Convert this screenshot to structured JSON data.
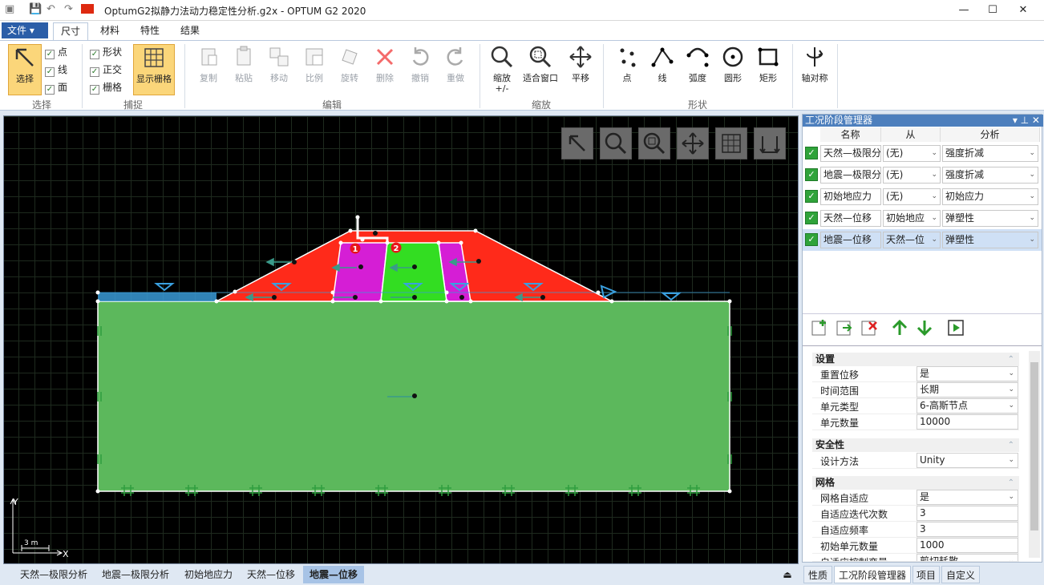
{
  "window": {
    "title": "OptumG2拟静力法动力稳定性分析.g2x - OPTUM G2 2020"
  },
  "menu": {
    "file": "文件 ▾",
    "tabs": [
      "尺寸",
      "材料",
      "特性",
      "结果"
    ]
  },
  "ribbon": {
    "select_group": {
      "label": "选择",
      "select_button": "选择",
      "checks": [
        "点",
        "线",
        "面"
      ]
    },
    "snap_group": {
      "label": "捕捉",
      "checks": [
        "形状",
        "正交",
        "栅格"
      ],
      "grid_button": "显示栅格"
    },
    "edit_group": {
      "label": "编辑",
      "buttons": [
        "复制",
        "粘贴",
        "移动",
        "比例",
        "旋转",
        "删除",
        "撤销",
        "重做"
      ]
    },
    "zoom_group": {
      "label": "缩放",
      "buttons": [
        "缩放\n+/-",
        "适合窗口",
        "平移"
      ],
      "zoom_line1": "缩放",
      "zoom_line2": "+/-"
    },
    "shape_group": {
      "label": "形状",
      "buttons": [
        "点",
        "线",
        "弧度",
        "圆形",
        "矩形"
      ]
    },
    "axis_button": "轴对称"
  },
  "canvas": {
    "axes": {
      "x": "X",
      "y": "Y",
      "scale": "3 m"
    },
    "markers": [
      "1",
      "2"
    ]
  },
  "bottom_tabs": [
    "天然—极限分析",
    "地震—极限分析",
    "初始地应力",
    "天然—位移",
    "地震—位移"
  ],
  "active_bottom_tab": "地震—位移",
  "stage_manager": {
    "title": "工况阶段管理器",
    "columns": [
      "名称",
      "从",
      "分析"
    ],
    "rows": [
      {
        "name": "天然—极限分",
        "from": "(无)",
        "analysis": "强度折减"
      },
      {
        "name": "地震—极限分",
        "from": "(无)",
        "analysis": "强度折减"
      },
      {
        "name": "初始地应力",
        "from": "(无)",
        "analysis": "初始应力"
      },
      {
        "name": "天然—位移",
        "from": "初始地应",
        "analysis": "弹塑性"
      },
      {
        "name": "地震—位移",
        "from": "天然—位",
        "analysis": "弹塑性"
      }
    ]
  },
  "properties": {
    "settings": {
      "title": "设置",
      "items": [
        {
          "key": "重置位移",
          "value": "是",
          "dropdown": true
        },
        {
          "key": "时间范围",
          "value": "长期",
          "dropdown": true
        },
        {
          "key": "单元类型",
          "value": "6-高斯节点",
          "dropdown": true
        },
        {
          "key": "单元数量",
          "value": "10000",
          "dropdown": false
        }
      ]
    },
    "safety": {
      "title": "安全性",
      "items": [
        {
          "key": "设计方法",
          "value": "Unity",
          "dropdown": true
        }
      ]
    },
    "mesh": {
      "title": "网格",
      "items": [
        {
          "key": "网格自适应",
          "value": "是",
          "dropdown": true
        },
        {
          "key": "自适应迭代次数",
          "value": "3",
          "dropdown": false
        },
        {
          "key": "自适应频率",
          "value": "3",
          "dropdown": false
        },
        {
          "key": "初始单元数量",
          "value": "1000",
          "dropdown": false
        },
        {
          "key": "自适应控制变量",
          "value": "剪切耗散",
          "dropdown": true
        }
      ]
    }
  },
  "panel_tabs": [
    "性质",
    "工况阶段管理器",
    "项目",
    "自定义"
  ],
  "colors": {
    "soil_green": "#5cb85c",
    "red": "#ff2a1a",
    "magenta": "#d51ed5",
    "bright_green": "#33dd22",
    "water_blue": "#3a9ad6"
  }
}
